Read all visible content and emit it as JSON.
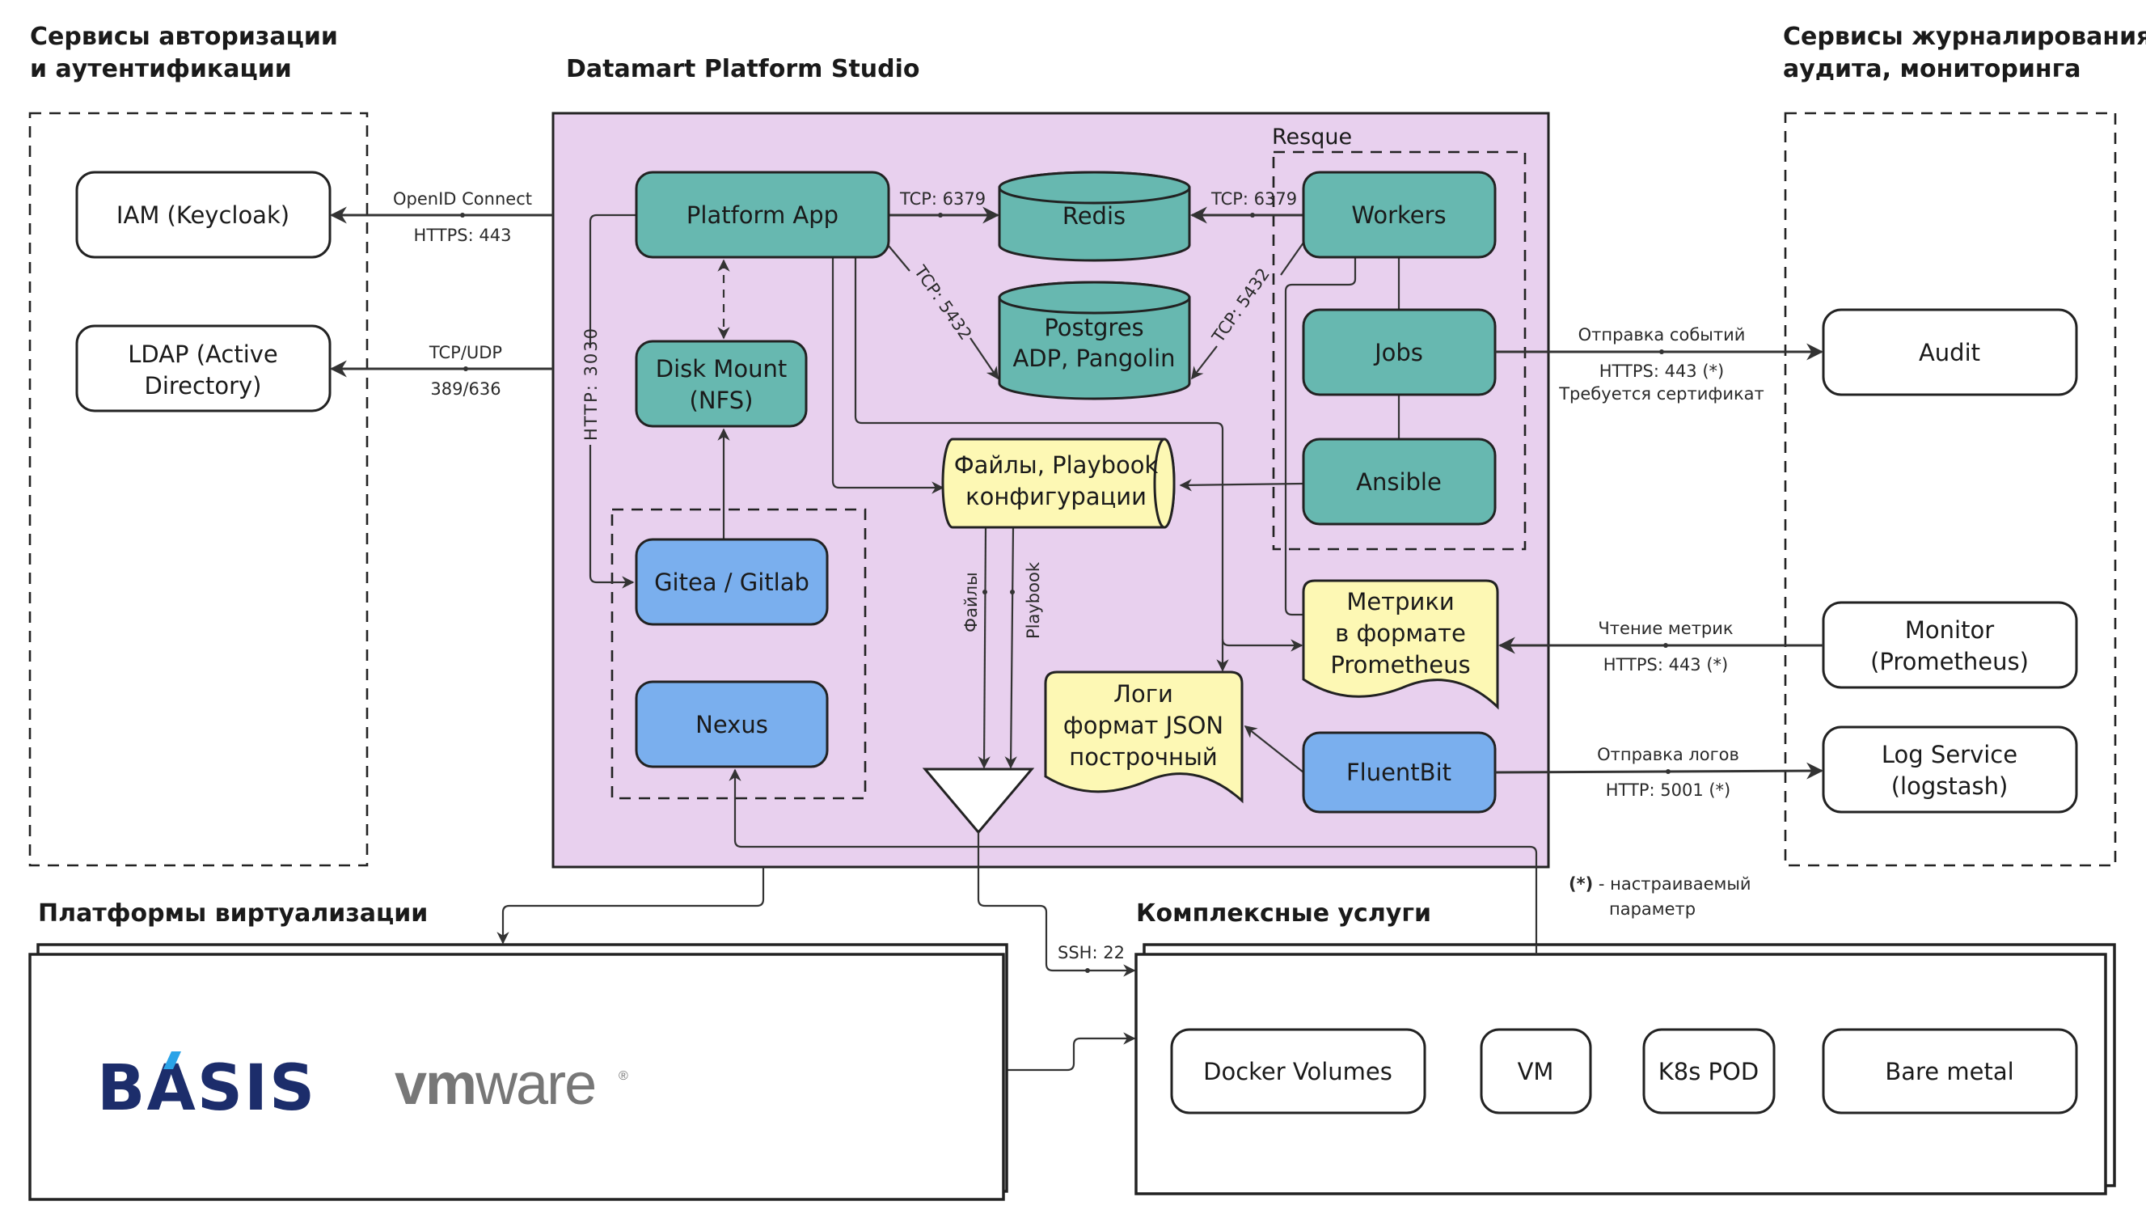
{
  "titles": {
    "auth_line1": "Сервисы авторизации",
    "auth_line2": "и аутентификации",
    "platform": "Datamart Platform Studio",
    "logging_line1": "Сервисы журналирования,",
    "logging_line2": "аудита, мониторинга",
    "virtualization": "Платформы виртуализации",
    "complex": "Комплексные услуги",
    "resque": "Resque"
  },
  "nodes": {
    "iam": "IAM (Keycloak)",
    "ldap_line1": "LDAP (Active",
    "ldap_line2": "Directory)",
    "platform_app": "Platform App",
    "redis": "Redis",
    "postgres_line1": "Postgres",
    "postgres_line2": "ADP, Pangolin",
    "workers": "Workers",
    "jobs": "Jobs",
    "ansible": "Ansible",
    "disk_mount_line1": "Disk Mount",
    "disk_mount_line2": "(NFS)",
    "files_line1": "Файлы, Playbook",
    "files_line2": "конфигурации",
    "gitea": "Gitea / Gitlab",
    "nexus": "Nexus",
    "logs_line1": "Логи",
    "logs_line2": "формат JSON",
    "logs_line3": "построчный",
    "metrics_line1": "Метрики",
    "metrics_line2": "в формате",
    "metrics_line3": "Prometheus",
    "fluentbit": "FluentBit",
    "audit": "Audit",
    "monitor_line1": "Monitor",
    "monitor_line2": "(Prometheus)",
    "logservice_line1": "Log Service",
    "logservice_line2": "(logstash)",
    "docker": "Docker Volumes",
    "vm": "VM",
    "k8s": "K8s POD",
    "baremetal": "Bare metal"
  },
  "edge_labels": {
    "oidc_top": "OpenID Connect",
    "oidc_bottom": "HTTPS: 443",
    "ldap_top": "TCP/UDP",
    "ldap_bottom": "389/636",
    "app_redis": "TCP: 6379",
    "workers_redis": "TCP: 6379",
    "app_postgres": "TCP: 5432",
    "workers_postgres": "TCP: 5432",
    "http3030": "HTTP: 3030",
    "files": "Файлы",
    "playbook": "Playbook",
    "audit_top": "Отправка событий",
    "audit_bottom1": "HTTPS: 443 (*)",
    "audit_bottom2": "Требуется сертификат",
    "metrics_top": "Чтение метрик",
    "metrics_bottom": "HTTPS: 443 (*)",
    "logs_top": "Отправка логов",
    "logs_bottom": "HTTP: 5001 (*)",
    "ssh": "SSH: 22"
  },
  "note": {
    "marker": "(*)",
    "line1": " - настраиваемый",
    "line2": "параметр"
  },
  "logos": {
    "basis": "BASIS",
    "vmware_vm": "vm",
    "vmware_ware": "ware",
    "vmware_reg": "®"
  },
  "colors": {
    "platform_bg": "#e8d0ee",
    "teal": "#67b8b0",
    "blue": "#7aafee",
    "yellow": "#fdf8b4",
    "basis_navy": "#1c2d6b",
    "basis_accent": "#2aa3e8",
    "vmware_gray": "#777777"
  }
}
